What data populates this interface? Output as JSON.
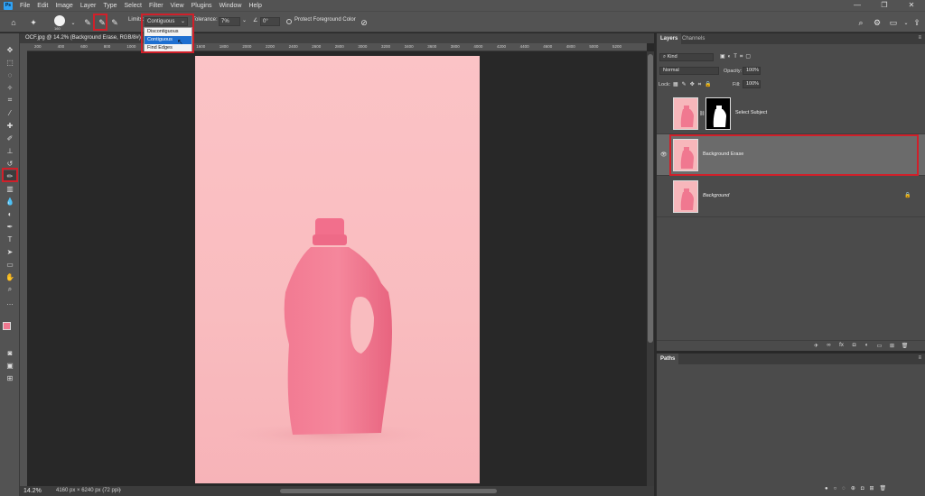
{
  "menubar": {
    "logo": "Ps",
    "items": [
      "File",
      "Edit",
      "Image",
      "Layer",
      "Type",
      "Select",
      "Filter",
      "View",
      "Plugins",
      "Window",
      "Help"
    ]
  },
  "options": {
    "brush_size": "160",
    "limits_label": "Limits:",
    "limits_value": "Contiguous",
    "tolerance_label": "Tolerance:",
    "tolerance_value": "7%",
    "angle_value": "0°",
    "protect_label": "Protect Foreground Color",
    "dropdown_options": [
      "Discontiguous",
      "Contiguous",
      "Find Edges"
    ]
  },
  "document": {
    "tab_title": "OCF.jpg @ 14.2% (Background Erase, RGB/8#)",
    "ruler_ticks": [
      "200",
      "400",
      "600",
      "800",
      "1000",
      "1200",
      "1400",
      "1600",
      "1800",
      "2000",
      "2200",
      "2400",
      "2600",
      "2800",
      "3000",
      "3200",
      "3400",
      "3600",
      "3800",
      "4000",
      "4200",
      "4400",
      "4600",
      "4800",
      "5000",
      "5200"
    ],
    "zoom": "14.2%",
    "dimensions": "4160 px × 6240 px (72 ppi)"
  },
  "layers_panel": {
    "tabs": [
      "Layers",
      "Channels"
    ],
    "filter": "Kind",
    "blend_mode": "Normal",
    "opacity_label": "Opacity:",
    "opacity_value": "100%",
    "lock_label": "Lock:",
    "fill_label": "Fill:",
    "fill_value": "100%",
    "layers": [
      {
        "name": "Select Subject"
      },
      {
        "name": "Background Erase"
      },
      {
        "name": "Background"
      }
    ]
  },
  "paths_panel": {
    "tabs": [
      "Paths"
    ]
  },
  "colors": {
    "accent_red": "#d0202a",
    "photo_pink": "#fbc3c6",
    "bottle_pink": "#f07890",
    "selection_blue": "#1e6fd0"
  }
}
